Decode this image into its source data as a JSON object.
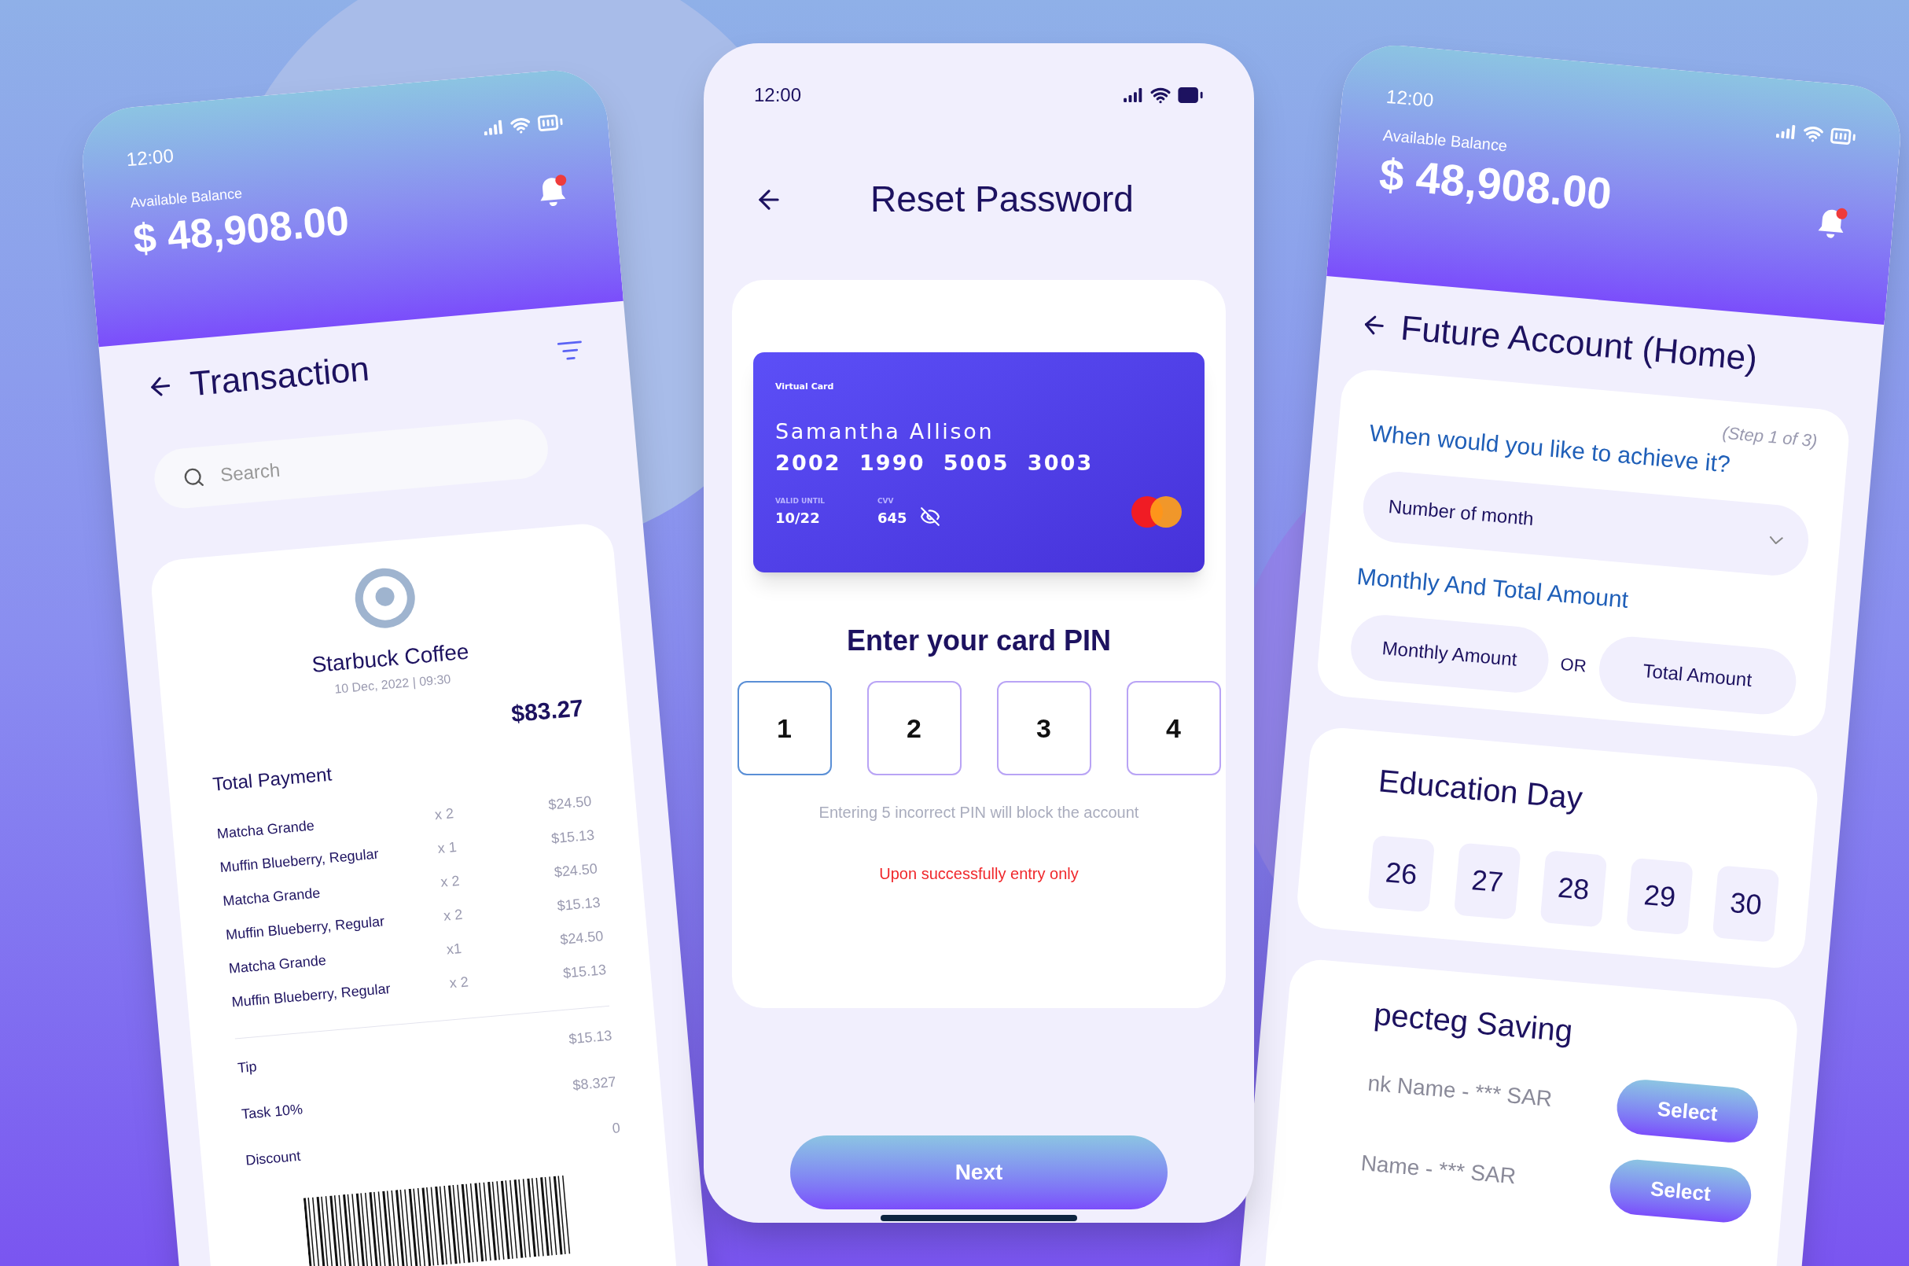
{
  "left_phone": {
    "status_time": "12:00",
    "balance_label": "Available Balance",
    "balance": "$ 48,908.00",
    "title": "Transaction",
    "search": {
      "placeholder": "Search"
    },
    "receipt": {
      "merchant": "Starbuck Coffee",
      "datetime": "10 Dec, 2022 | 09:30",
      "total_label": "Total Payment",
      "total": "$83.27",
      "items": [
        {
          "name": "Matcha Grande",
          "qty": "x 2",
          "price": "$24.50"
        },
        {
          "name": "Muffin Blueberry, Regular",
          "qty": "x 1",
          "price": "$15.13"
        },
        {
          "name": "Matcha Grande",
          "qty": "x 2",
          "price": "$24.50"
        },
        {
          "name": "Muffin Blueberry, Regular",
          "qty": "x 2",
          "price": "$15.13"
        },
        {
          "name": "Matcha Grande",
          "qty": "x1",
          "price": "$24.50"
        },
        {
          "name": "Muffin Blueberry, Regular",
          "qty": "x 2",
          "price": "$15.13"
        }
      ],
      "extras": [
        {
          "label": "Tip",
          "value": "$15.13"
        },
        {
          "label": "Task 10%",
          "value": "$8.327"
        },
        {
          "label": "Discount",
          "value": "0"
        }
      ]
    }
  },
  "center_phone": {
    "status_time": "12:00",
    "title": "Reset Password",
    "card": {
      "type_label": "Virtual Card",
      "holder": "Samantha Allison",
      "number": "2002  1990  5005  3003",
      "valid_label": "VALID UNTIL",
      "valid": "10/22",
      "cvv_label": "CVV",
      "cvv": "645"
    },
    "pin_heading": "Enter your card PIN",
    "pin_digits": [
      {
        "value": "1",
        "focused": true
      },
      {
        "value": "2",
        "focused": false
      },
      {
        "value": "3",
        "focused": false
      },
      {
        "value": "4",
        "focused": false
      }
    ],
    "warning": "Entering 5 incorrect PIN will block the account",
    "notice": "Upon successfully entry only",
    "button": "Next"
  },
  "right_phone": {
    "status_time": "12:00",
    "balance_label": "Available Balance",
    "balance": "$ 48,908.00",
    "title": "Future Account (Home)",
    "step": "(Step 1 of 3)",
    "question": "When would you like to achieve it?",
    "dropdown": "Number of month",
    "amount_heading": "Monthly And Total Amount",
    "amount_options": [
      "Monthly Amount",
      "Total Amount"
    ],
    "or_label": "OR",
    "day_heading": "Education Day",
    "days": [
      "26",
      "27",
      "28",
      "29",
      "30"
    ],
    "saving_heading": "pecteg Saving",
    "saving_rows": [
      {
        "text": "nk Name - *** SAR",
        "button": "Select"
      },
      {
        "text": "Name - *** SAR",
        "button": "Select"
      }
    ]
  }
}
